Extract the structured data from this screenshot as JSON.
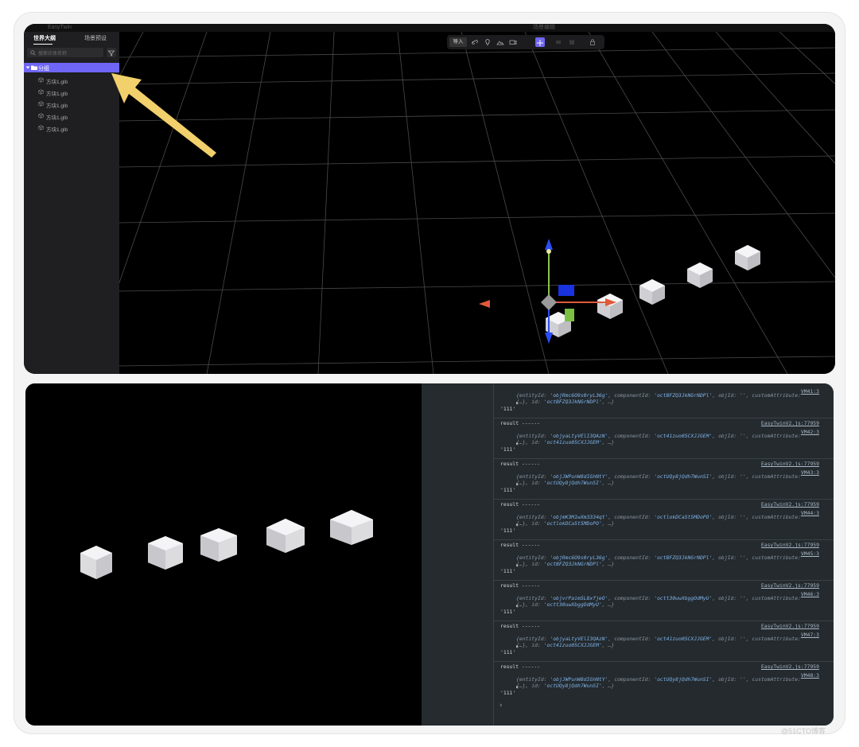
{
  "sidebar": {
    "tab_outline": "世界大纲",
    "tab_scene": "场景预设",
    "search_placeholder": "搜索实体名称",
    "group_label": "分组",
    "items": [
      {
        "label": "方块1.glb"
      },
      {
        "label": "方块1.glb"
      },
      {
        "label": "方块1.glb"
      },
      {
        "label": "方块1.glb"
      },
      {
        "label": "方块1.glb"
      }
    ]
  },
  "titlebar": {
    "left": "EasyTwin",
    "center": "场景编辑"
  },
  "toolbar": {
    "import_label": "导入"
  },
  "console": {
    "entries": [
      {
        "vm": "VM41:3",
        "entity": "objRmc6O9s0ryL36g",
        "component": "octBFZQ3JkNGrNDPl",
        "id": "octBFZQ3JkNGrNDPl"
      },
      {
        "vm": "VM42:3",
        "entity": "objyaLtyVElI3QAzN",
        "component": "oct41zuo05CXJJGEM",
        "id": "oct41zuo05CXJJGEM"
      },
      {
        "vm": "VM43:3",
        "entity": "objJWPunW8dIGhNtY",
        "component": "octUQy8jQdh7WunSI",
        "id": "octUQy8jQdh7WunSI"
      },
      {
        "vm": "VM44:3",
        "entity": "objmK3M1wXm3334qt",
        "component": "octlokDCa5t5MDoPO",
        "id": "octlokDCa5t5MDoPO"
      },
      {
        "vm": "VM45:3",
        "entity": "objRmc6O9s0ryL36g",
        "component": "octBFZQ3JkNGrNDPl",
        "id": "octBFZQ3JkNGrNDPl"
      },
      {
        "vm": "VM46:3",
        "entity": "objvrPaim5L8xfjeO",
        "component": "octt30uwXbggOdMyU",
        "id": "octt30uwXbggOdMyU"
      },
      {
        "vm": "VM47:3",
        "entity": "objyaLtyVElI3QAzN",
        "component": "oct41zuo05CXJJGEM",
        "id": "oct41zuo05CXJJGEM"
      },
      {
        "vm": "VM48:3",
        "entity": "objJWPunW8dIGhNtY",
        "component": "octUQy8jQdh7WunSI",
        "id": "octUQy8jQdh7WunSI"
      }
    ],
    "result_text": "result ------",
    "result_link": "EasyTwinV2.js:77959",
    "string_value": "'111'",
    "prompt": "›"
  },
  "watermark": "@51CTO博客",
  "colors": {
    "accent": "#6f66f5",
    "arrow": "#f2d06b"
  }
}
